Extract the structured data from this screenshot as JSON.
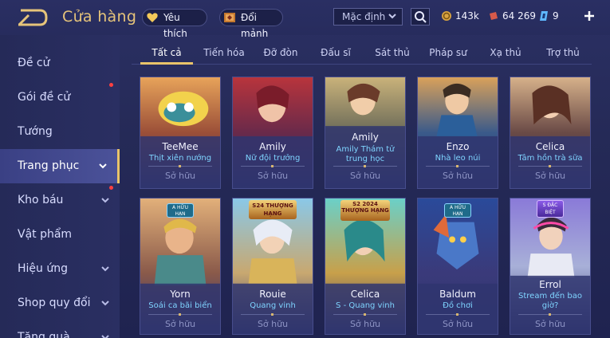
{
  "header": {
    "title": "Cửa hàng",
    "favorites_label": "Yêu thích",
    "fragments_label": "Đổi mảnh",
    "sort_label": "Mặc định",
    "currencies": {
      "gold": "143k",
      "vouchers": "64 269",
      "quan_huy": "9"
    }
  },
  "sidebar": {
    "items": [
      {
        "label": "Đề cử"
      },
      {
        "label": "Gói đề cử"
      },
      {
        "label": "Tướng"
      },
      {
        "label": "Trang phục"
      },
      {
        "label": "Kho báu"
      },
      {
        "label": "Vật phẩm"
      },
      {
        "label": "Hiệu ứng"
      },
      {
        "label": "Shop quy đổi"
      },
      {
        "label": "Tặng quà"
      }
    ]
  },
  "tabs": [
    "Tất cả",
    "Tiến hóa",
    "Đỡ đòn",
    "Đấu sĩ",
    "Sát thủ",
    "Pháp sư",
    "Xạ thủ",
    "Trợ thủ"
  ],
  "owned_label": "Sở hữu",
  "cards": [
    {
      "name": "TeeMee",
      "skin": "Thịt xiên nướng"
    },
    {
      "name": "Amily",
      "skin": "Nữ đội trưởng"
    },
    {
      "name": "Amily",
      "skin": "Amily Thám tử trung học"
    },
    {
      "name": "Enzo",
      "skin": "Nhà leo núi"
    },
    {
      "name": "Celica",
      "skin": "Tâm hồn trà sữa"
    },
    {
      "name": "Yorn",
      "skin": "Soái ca bãi biển",
      "badge": "A HỮU HẠN"
    },
    {
      "name": "Rouie",
      "skin": "Quang vinh",
      "badge": "S24 THƯỢNG HẠNG"
    },
    {
      "name": "Celica",
      "skin": "S - Quang vinh",
      "badge": "S2 2024 THƯỢNG HẠNG"
    },
    {
      "name": "Baldum",
      "skin": "Đồ chơi",
      "badge": "A HỮU HẠN"
    },
    {
      "name": "Errol",
      "skin": "Stream đến bao giờ?",
      "badge": "S ĐẶC BIỆT"
    }
  ],
  "colors": {
    "accent": "#e9c46a",
    "skin_name": "#7fd4ff",
    "background": "#262b55"
  }
}
